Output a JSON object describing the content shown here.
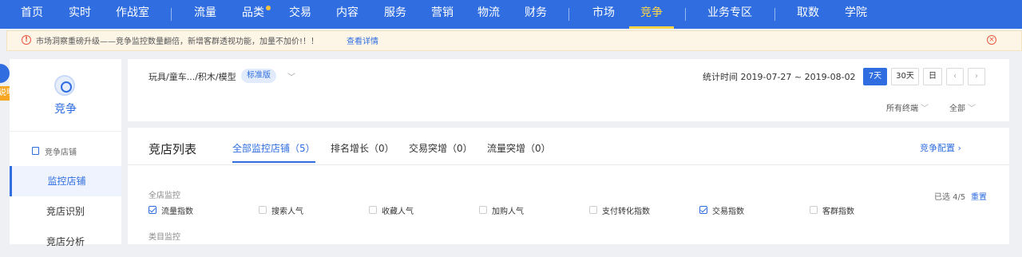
{
  "nav": {
    "items": [
      "首页",
      "实时",
      "作战室",
      "流量",
      "品类",
      "交易",
      "内容",
      "服务",
      "营销",
      "物流",
      "财务",
      "市场",
      "竞争",
      "业务专区",
      "取数",
      "学院"
    ],
    "active": "竞争"
  },
  "notice": {
    "text": "市场洞察重磅升级——竞争监控数量翻倍，新增客群透视功能，加量不加价!！！",
    "link": "查看详情"
  },
  "helper": {
    "label": "说明"
  },
  "sidebar": {
    "title": "竞争",
    "section": "竞争店铺",
    "items": [
      "监控店铺",
      "竞店识别",
      "竞店分析"
    ]
  },
  "filter": {
    "breadcrumb": "玩具/童车.../积木/模型",
    "edition": "标准版",
    "stat_time": "统计时间 2019-07-27 ~ 2019-08-02",
    "range_buttons": [
      "7天",
      "30天",
      "日"
    ],
    "terminal": "所有终端",
    "scope": "全部"
  },
  "panel": {
    "title": "竞店列表",
    "tabs": [
      "全部监控店铺（5）",
      "排名增长（0）",
      "交易突增（0）",
      "流量突增（0）"
    ],
    "config": "竞争配置",
    "group_label": "全店监控",
    "group_label2": "类目监控",
    "selected": "已选 4/5",
    "reset": "重置",
    "metrics": [
      {
        "label": "流量指数",
        "checked": true
      },
      {
        "label": "搜索人气",
        "checked": false
      },
      {
        "label": "收藏人气",
        "checked": false
      },
      {
        "label": "加购人气",
        "checked": false
      },
      {
        "label": "支付转化指数",
        "checked": false
      },
      {
        "label": "交易指数",
        "checked": true
      },
      {
        "label": "客群指数",
        "checked": false
      }
    ]
  },
  "colors": {
    "primary": "#2f6de0",
    "accent": "#ffd54a",
    "warning": "#e8573e"
  }
}
